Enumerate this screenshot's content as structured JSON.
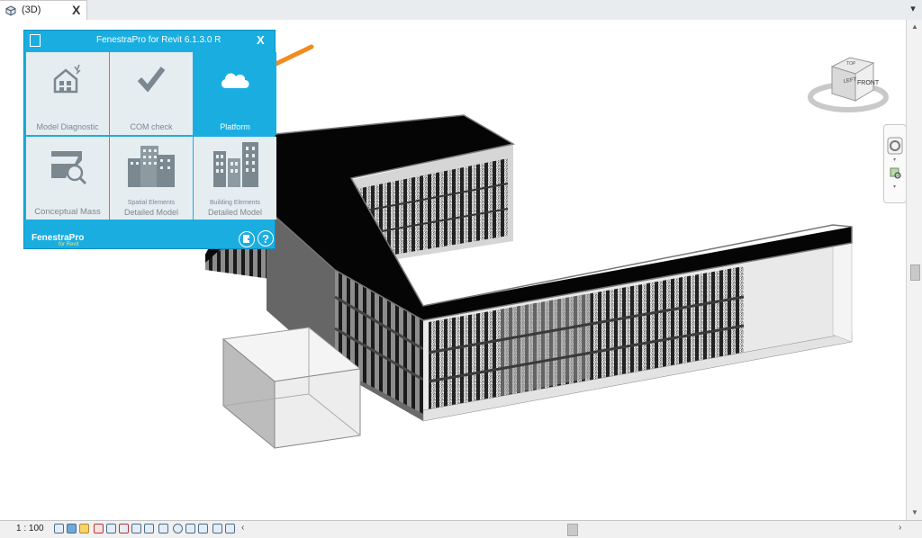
{
  "tab": {
    "label": "(3D)",
    "close": "X",
    "icon": "3d-view-icon"
  },
  "panel": {
    "title": "FenestraPro for Revit  6.1.3.0  R",
    "close": "X",
    "tiles": [
      {
        "label": "Model Diagnostic",
        "icon": "house-diagnostic-icon"
      },
      {
        "label": "COM check",
        "icon": "checkmark-icon"
      },
      {
        "label": "Platform",
        "icon": "cloud-icon",
        "active": true
      },
      {
        "label": "Conceptual Mass",
        "icon": "conceptual-mass-icon"
      },
      {
        "sublabel": "Spatial Elements",
        "label": "Detailed Model",
        "icon": "building-icon"
      },
      {
        "sublabel": "Building Elements",
        "label": "Detailed Model",
        "icon": "buildings-icon"
      }
    ],
    "brand": "FenestraPro",
    "brand_sub": "for Revit",
    "help": "?"
  },
  "viewcube": {
    "face": "FRONT",
    "top_face": "TOP",
    "left_face": "LEFT"
  },
  "status": {
    "scale": "1 : 100"
  },
  "colors": {
    "panel": "#1aaee0",
    "arrow": "#f28a1e",
    "roof": "#050505",
    "tile_bg": "#e5edf1"
  }
}
